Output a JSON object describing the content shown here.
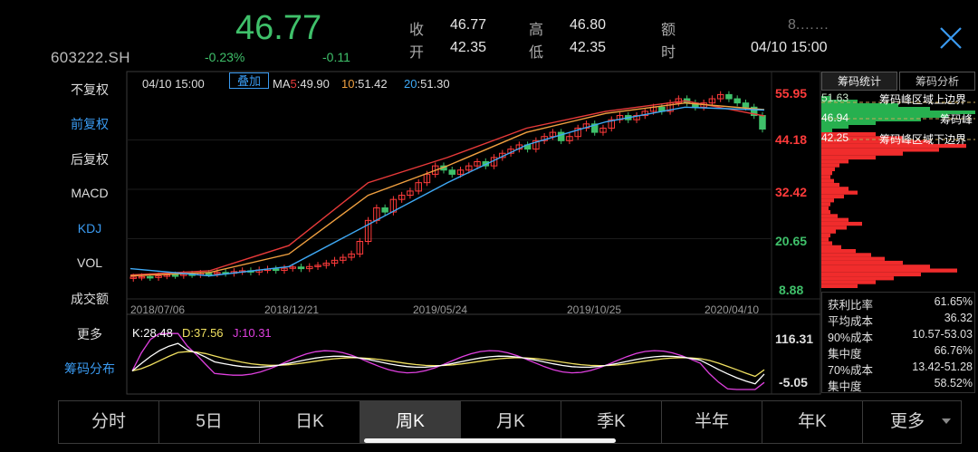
{
  "header": {
    "code": "603222.SH",
    "price": "46.77",
    "pct_change": "-0.23%",
    "change": "-0.11",
    "quote": [
      {
        "label": "收",
        "value": "46.77"
      },
      {
        "label": "开",
        "value": "42.35"
      },
      {
        "label": "高",
        "value": "46.80"
      },
      {
        "label": "低",
        "value": "42.35"
      },
      {
        "label": "额",
        "value": "8.……"
      },
      {
        "label": "时",
        "value": "04/10 15:00"
      }
    ]
  },
  "menu": {
    "items": [
      "不复权",
      "前复权",
      "后复权",
      "MACD",
      "KDJ",
      "VOL",
      "成交额",
      "更多",
      "筹码分布"
    ],
    "active": [
      "前复权",
      "KDJ",
      "筹码分布"
    ]
  },
  "chart_overlay": {
    "date": "04/10 15:00",
    "overlay_button": "叠加",
    "ma": [
      {
        "key": "MA5",
        "label": "MA",
        "num": "5",
        "value": "49.90",
        "color": "#e83a3a"
      },
      {
        "key": "MA10",
        "label": "",
        "num": "10",
        "value": "51.42",
        "color": "#f0a040"
      },
      {
        "key": "MA20",
        "label": "",
        "num": "20",
        "value": "51.30",
        "color": "#3fa9f5"
      }
    ],
    "kdj": [
      {
        "label": "K:",
        "value": "28.48",
        "color": "#ffffff"
      },
      {
        "label": "D:",
        "value": "37.56",
        "color": "#f0e060"
      },
      {
        "label": "J:",
        "value": "10.31",
        "color": "#e040e0"
      }
    ]
  },
  "axis": {
    "price_ticks": [
      {
        "value": "55.95",
        "color": "#ff3b3b"
      },
      {
        "value": "44.18",
        "color": "#ff3b3b"
      },
      {
        "value": "32.42",
        "color": "#ff3b3b"
      },
      {
        "value": "20.65",
        "color": "#3fc06a"
      },
      {
        "value": "8.88",
        "color": "#3fc06a"
      }
    ],
    "dates": [
      "2018/07/06",
      "2018/12/21",
      "2019/05/24",
      "2019/10/25",
      "2020/04/10"
    ],
    "kdj_ticks": [
      "116.31",
      "-5.05"
    ]
  },
  "chip_panel": {
    "tabs": [
      "筹码统计",
      "筹码分析"
    ],
    "active_tab": "筹码统计",
    "levels": [
      {
        "price": "51.63",
        "label": "筹码峰区域上边界"
      },
      {
        "price": "46.94",
        "label": "筹码峰"
      },
      {
        "price": "42.25",
        "label": "筹码峰区域下边界"
      }
    ],
    "stats": [
      {
        "label": "获利比率",
        "value": "61.65%"
      },
      {
        "label": "平均成本",
        "value": "36.32"
      },
      {
        "label": "90%成本",
        "value": "10.57-53.03"
      },
      {
        "label": "集中度",
        "value": "66.76%"
      },
      {
        "label": "70%成本",
        "value": "13.42-51.28"
      },
      {
        "label": "集中度",
        "value": "58.52%"
      }
    ]
  },
  "periods": {
    "items": [
      "分时",
      "5日",
      "日K",
      "周K",
      "月K",
      "季K",
      "半年",
      "年K",
      "更多"
    ],
    "active": "周K"
  },
  "colors": {
    "up": "#ff3b3b",
    "down": "#3fc06a",
    "accent": "#3a9af0"
  },
  "chart_data": {
    "type": "candlestick",
    "title": "",
    "x": [
      "2018/07/06",
      "2018/12/21",
      "2019/05/24",
      "2019/10/25",
      "2020/04/10"
    ],
    "ylim": [
      8.88,
      55.95
    ],
    "series": [
      {
        "name": "MA5",
        "x": [
          "2018/07/06",
          "2018/12/21",
          "2019/03/01",
          "2019/05/24",
          "2019/08/09",
          "2019/10/25",
          "2020/01/10",
          "2020/03/20",
          "2020/04/10"
        ],
        "values": [
          12.0,
          13.0,
          19.0,
          34.0,
          40.0,
          47.0,
          51.0,
          53.5,
          49.9
        ]
      },
      {
        "name": "MA10",
        "x": [
          "2018/07/06",
          "2018/12/21",
          "2019/03/01",
          "2019/05/24",
          "2019/08/09",
          "2019/10/25",
          "2020/01/10",
          "2020/03/20",
          "2020/04/10"
        ],
        "values": [
          11.8,
          12.6,
          17.0,
          31.0,
          38.0,
          46.0,
          50.5,
          53.0,
          51.42
        ]
      },
      {
        "name": "MA20",
        "x": [
          "2018/07/06",
          "2018/12/21",
          "2019/03/01",
          "2019/05/24",
          "2019/08/09",
          "2019/10/25",
          "2020/01/10",
          "2020/03/20",
          "2020/04/10"
        ],
        "values": [
          13.5,
          11.8,
          14.0,
          24.0,
          34.0,
          43.0,
          48.5,
          52.0,
          51.3
        ]
      }
    ],
    "candles_weekly_close_estimate": [
      11.5,
      11.6,
      11.4,
      11.8,
      12.0,
      11.9,
      12.2,
      12.1,
      12.4,
      12.3,
      12.6,
      12.4,
      12.8,
      13.0,
      12.7,
      13.2,
      13.4,
      13.1,
      13.6,
      13.9,
      13.5,
      14.0,
      14.3,
      14.8,
      15.5,
      16.2,
      17.0,
      20.0,
      25.0,
      28.0,
      27.0,
      30.0,
      31.0,
      32.0,
      34.0,
      36.0,
      38.0,
      37.0,
      36.0,
      37.0,
      38.0,
      39.0,
      38.0,
      40.0,
      41.0,
      42.0,
      43.0,
      42.0,
      44.0,
      45.0,
      46.0,
      44.0,
      45.0,
      47.0,
      48.0,
      46.0,
      47.0,
      49.0,
      50.0,
      49.0,
      50.0,
      51.0,
      52.0,
      51.0,
      53.0,
      54.0,
      53.0,
      52.0,
      53.0,
      54.0,
      55.0,
      54.0,
      53.0,
      52.0,
      50.0,
      46.77
    ],
    "kdj": {
      "K": 28.48,
      "D": 37.56,
      "J": 10.31,
      "ylim": [
        -5.05,
        116.31
      ]
    }
  }
}
